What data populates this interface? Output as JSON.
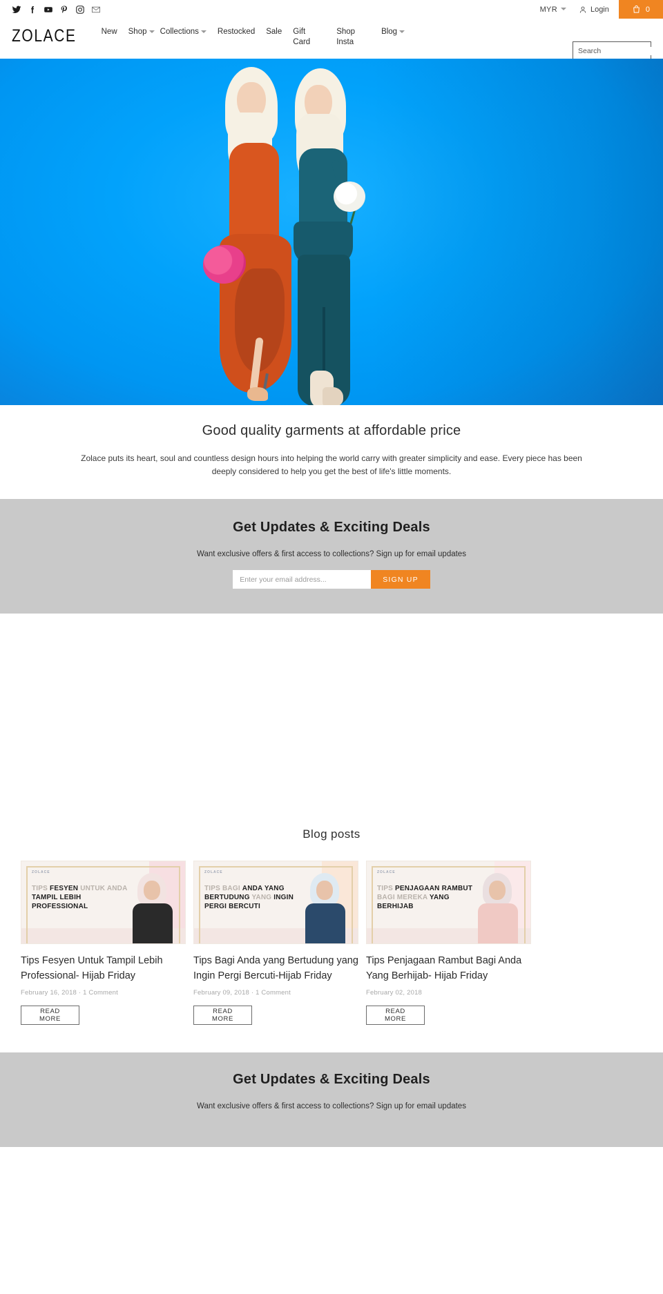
{
  "topbar": {
    "social": [
      {
        "name": "twitter-icon",
        "label": "Twitter"
      },
      {
        "name": "facebook-icon",
        "label": "Facebook"
      },
      {
        "name": "youtube-icon",
        "label": "YouTube"
      },
      {
        "name": "pinterest-icon",
        "label": "Pinterest"
      },
      {
        "name": "instagram-icon",
        "label": "Instagram"
      },
      {
        "name": "email-icon",
        "label": "Email"
      }
    ],
    "currency": "MYR",
    "login": "Login",
    "cart_count": "0"
  },
  "header": {
    "logo": "ZOLACE",
    "nav": [
      {
        "label": "New",
        "dropdown": false
      },
      {
        "label": "Shop",
        "dropdown": true
      },
      {
        "label": "Collections",
        "dropdown": true
      },
      {
        "label": "Restocked",
        "dropdown": false
      },
      {
        "label": "Sale",
        "dropdown": false
      },
      {
        "label": "Gift\nCard",
        "dropdown": false
      },
      {
        "label": "Shop\nInsta",
        "dropdown": false
      },
      {
        "label": "Blog",
        "dropdown": true
      }
    ],
    "search_placeholder": "Search",
    "search_value": ""
  },
  "hero": {
    "background_color": "#02a2fb",
    "alt": "Two models wearing hijab in orange and teal outfits on blue background"
  },
  "tagline": {
    "title": "Good quality garments at affordable price",
    "body": "Zolace puts its heart, soul and countless design hours into helping the world carry with greater simplicity and ease. Every piece has been deeply considered to help you get the best of life's little moments."
  },
  "newsletter": {
    "title": "Get Updates & Exciting Deals",
    "subtitle": "Want exclusive offers & first access to collections? Sign up for email updates",
    "input_placeholder": "Enter your email address...",
    "input_value": "",
    "button": "SIGN UP",
    "accent_color": "#f08521",
    "background_color": "#c9c9c9"
  },
  "blog": {
    "heading": "Blog posts",
    "read_more_label": "READ\nMORE",
    "posts": [
      {
        "title": "Tips Fesyen Untuk Tampil Lebih Professional- Hijab Friday",
        "meta": "February 16, 2018 · 1 Comment",
        "thumb_brand": "ZOLACE",
        "thumb_line1": "TIPS ",
        "thumb_bold1": "FESYEN",
        "thumb_line2": " UNTUK ANDA ",
        "thumb_bold2": "TAMPIL LEBIH PROFESSIONAL",
        "outfit_color": "#2a2a2a",
        "panel_color": "#f7dfe2"
      },
      {
        "title": "Tips Bagi Anda yang Bertudung yang Ingin Pergi Bercuti-Hijab Friday",
        "meta": "February 09, 2018 · 1 Comment",
        "thumb_brand": "ZOLACE",
        "thumb_line1": "TIPS BAGI ",
        "thumb_bold1": "ANDA YANG BERTUDUNG",
        "thumb_line2": " YANG ",
        "thumb_bold2": "INGIN PERGI BERCUTI",
        "outfit_color": "#2b4a6b",
        "panel_color": "#fae7d8"
      },
      {
        "title": "Tips Penjagaan Rambut Bagi Anda Yang Berhijab- Hijab Friday",
        "meta": "February 02, 2018",
        "thumb_brand": "ZOLACE",
        "thumb_line1": "TIPS ",
        "thumb_bold1": "PENJAGAAN RAMBUT",
        "thumb_line2": " BAGI MEREKA ",
        "thumb_bold2": "YANG BERHIJAB",
        "outfit_color": "#f0c9c4",
        "panel_color": "#fbe9ea"
      }
    ]
  }
}
